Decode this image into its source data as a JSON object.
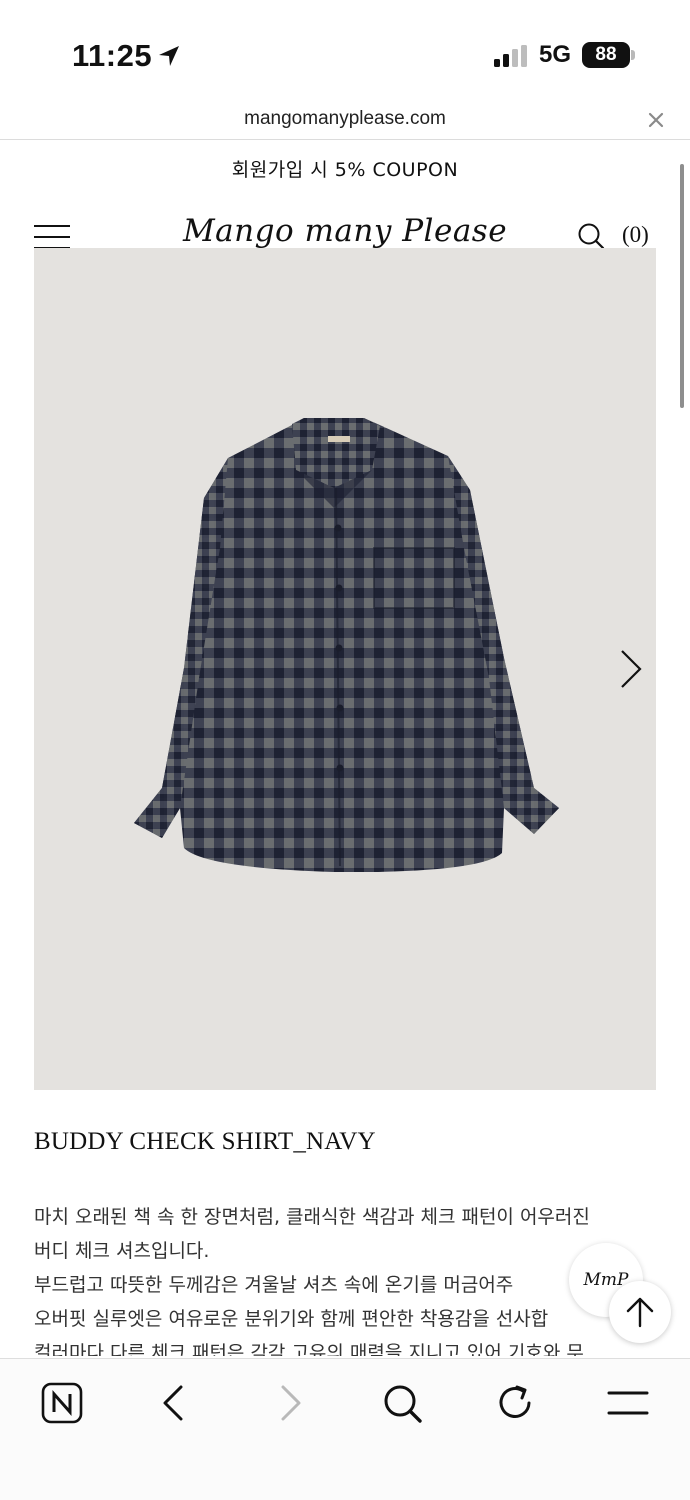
{
  "status_bar": {
    "time": "11:25",
    "network": "5G",
    "battery": "88",
    "icons": [
      "location-arrow-icon",
      "signal-icon"
    ]
  },
  "browser": {
    "url": "mangomanyplease.com"
  },
  "promo": {
    "text": "회원가입 시 5% COUPON"
  },
  "header": {
    "logo": "Mango many Please",
    "cart_count": "(0)",
    "icons": [
      "menu-icon",
      "search-icon"
    ]
  },
  "product": {
    "title": "BUDDY CHECK SHIRT_NAVY",
    "description": [
      "마치 오래된 책 속 한 장면처럼, 클래식한 색감과 체크 패턴이 어우러진",
      "버디 체크 셔츠입니다.",
      "부드럽고 따뜻한 두께감은 겨울날 셔츠 속에 온기를 머금어주",
      "오버핏 실루엣은 여유로운 분위기와 함께 편안한 착용감을 선사합",
      "컬러마다 다른 체크 패턴은 각각 고유의 매력을 지니고 있어 기호와 무"
    ]
  },
  "floating": {
    "badge": "MmP"
  },
  "colors": {
    "image_bg": "#e4e2df",
    "shirt_navy": "#262b3d",
    "shirt_gray": "#6a6d70"
  },
  "toolbar": {
    "icons": [
      "naver-home-icon",
      "back-icon",
      "forward-icon",
      "search-icon",
      "refresh-icon",
      "menu-icon"
    ]
  }
}
